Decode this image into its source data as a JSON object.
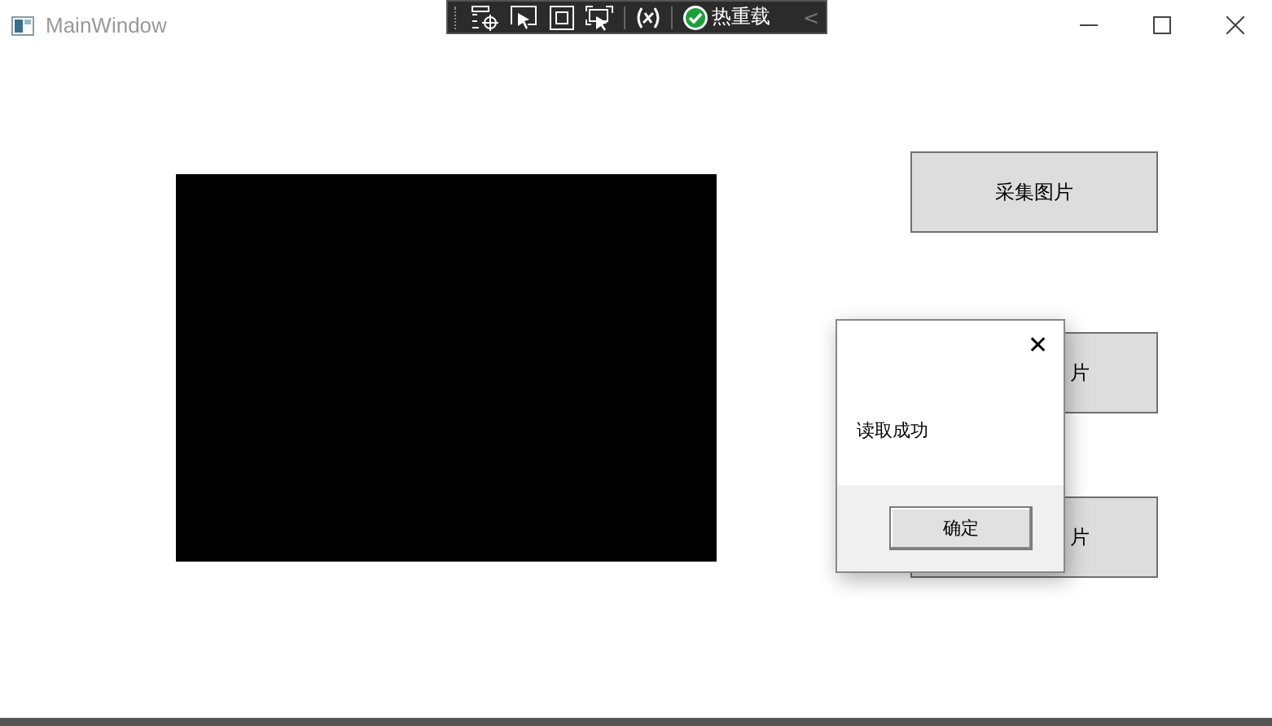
{
  "window": {
    "title": "MainWindow"
  },
  "debug_toolbar": {
    "hot_reload_label": "热重载",
    "collapse_glyph": "<"
  },
  "buttons": [
    {
      "label": "采集图片"
    },
    {
      "label": "片"
    },
    {
      "label": "片"
    }
  ],
  "dialog": {
    "message": "读取成功",
    "ok_button": "确定",
    "close_glyph": "✕"
  }
}
